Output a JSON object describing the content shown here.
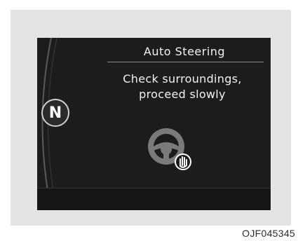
{
  "display": {
    "title": "Auto Steering",
    "message_line1": "Check surroundings,",
    "message_line2": "proceed slowly",
    "gear": "N",
    "icon": "steering-wheel-hands-off-icon"
  },
  "caption": "OJF045345",
  "colors": {
    "screen_background": "#1c1c1c",
    "text": "#f2f2f2",
    "frame": "#e4e4e4"
  }
}
